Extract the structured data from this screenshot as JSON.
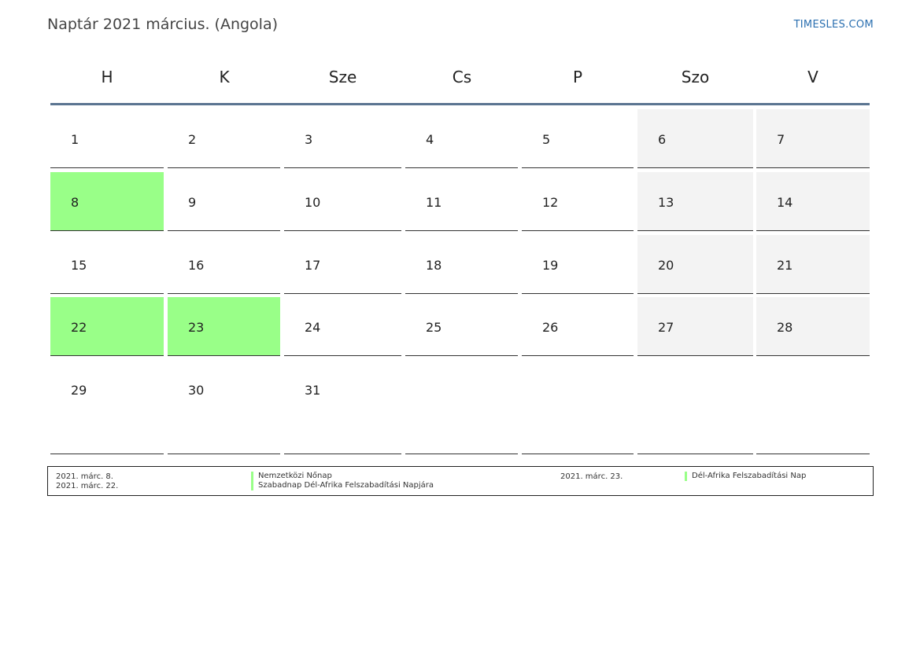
{
  "header": {
    "title": "Naptár 2021 március. (Angola)",
    "site": "TIMESLES.COM"
  },
  "weekdays": [
    "H",
    "K",
    "Sze",
    "Cs",
    "P",
    "Szo",
    "V"
  ],
  "weeks": [
    [
      {
        "day": "1",
        "type": "normal"
      },
      {
        "day": "2",
        "type": "normal"
      },
      {
        "day": "3",
        "type": "normal"
      },
      {
        "day": "4",
        "type": "normal"
      },
      {
        "day": "5",
        "type": "normal"
      },
      {
        "day": "6",
        "type": "weekend"
      },
      {
        "day": "7",
        "type": "weekend"
      }
    ],
    [
      {
        "day": "8",
        "type": "holiday"
      },
      {
        "day": "9",
        "type": "normal"
      },
      {
        "day": "10",
        "type": "normal"
      },
      {
        "day": "11",
        "type": "normal"
      },
      {
        "day": "12",
        "type": "normal"
      },
      {
        "day": "13",
        "type": "weekend"
      },
      {
        "day": "14",
        "type": "weekend"
      }
    ],
    [
      {
        "day": "15",
        "type": "normal"
      },
      {
        "day": "16",
        "type": "normal"
      },
      {
        "day": "17",
        "type": "normal"
      },
      {
        "day": "18",
        "type": "normal"
      },
      {
        "day": "19",
        "type": "normal"
      },
      {
        "day": "20",
        "type": "weekend"
      },
      {
        "day": "21",
        "type": "weekend"
      }
    ],
    [
      {
        "day": "22",
        "type": "holiday"
      },
      {
        "day": "23",
        "type": "holiday"
      },
      {
        "day": "24",
        "type": "normal"
      },
      {
        "day": "25",
        "type": "normal"
      },
      {
        "day": "26",
        "type": "normal"
      },
      {
        "day": "27",
        "type": "weekend"
      },
      {
        "day": "28",
        "type": "weekend"
      }
    ],
    [
      {
        "day": "29",
        "type": "normal"
      },
      {
        "day": "30",
        "type": "normal"
      },
      {
        "day": "31",
        "type": "normal"
      },
      {
        "day": "",
        "type": "empty"
      },
      {
        "day": "",
        "type": "empty"
      },
      {
        "day": "",
        "type": "empty"
      },
      {
        "day": "",
        "type": "empty"
      }
    ]
  ],
  "holidays": [
    {
      "date": "2021. márc. 8.",
      "name": "Nemzetközi Nőnap"
    },
    {
      "date": "2021. márc. 22.",
      "name": "Szabadnap Dél-Afrika Felszabadítási Napjára"
    },
    {
      "date": "2021. márc. 23.",
      "name": "Dél-Afrika Felszabadítási Nap"
    }
  ],
  "colors": {
    "holiday": "#99ff88",
    "weekend": "#f3f3f3",
    "header_rule": "#5b7591",
    "link": "#2a6fb0"
  }
}
